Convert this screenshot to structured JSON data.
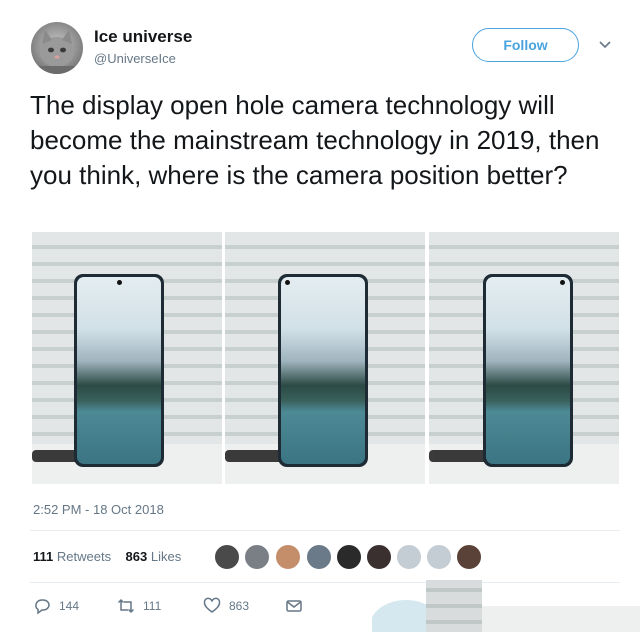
{
  "author": {
    "name": "Ice universe",
    "handle": "@UniverseIce"
  },
  "follow_label": "Follow",
  "tweet_text": "The display open hole camera technology will become the mainstream technology in 2019, then you think, where is the camera position better?",
  "timestamp": "2:52 PM - 18 Oct 2018",
  "stats": {
    "retweets_count": "111",
    "retweets_label": "Retweets",
    "likes_count": "863",
    "likes_label": "Likes"
  },
  "actions": {
    "reply_count": "144",
    "retweet_count": "111",
    "like_count": "863"
  },
  "colors": {
    "accent": "#4aa3df",
    "secondary_text": "#657786"
  },
  "icons": [
    "chevron-down-icon",
    "reply-icon",
    "retweet-icon",
    "heart-icon",
    "message-icon"
  ]
}
